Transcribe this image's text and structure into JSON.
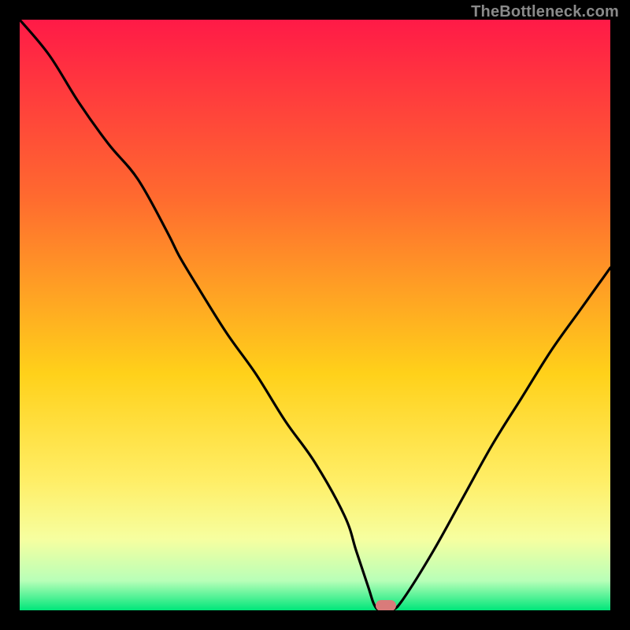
{
  "watermark": "TheBottleneck.com",
  "colors": {
    "top": "#ff1a47",
    "mid1": "#ff6a2f",
    "mid2": "#ffd11a",
    "mid3": "#ffee66",
    "mid4": "#f6ffa0",
    "low": "#b8ffb8",
    "bottom": "#00e67a",
    "curve": "#000000",
    "marker": "#d97b7a",
    "frame": "#000000"
  },
  "chart_data": {
    "type": "line",
    "title": "",
    "xlabel": "",
    "ylabel": "",
    "xlim": [
      0,
      100
    ],
    "ylim": [
      0,
      100
    ],
    "grid": false,
    "legend": false,
    "annotations": [],
    "series": [
      {
        "name": "bottleneck-curve",
        "x": [
          0,
          5,
          10,
          15,
          20,
          25,
          27,
          30,
          35,
          40,
          45,
          50,
          55,
          57,
          59,
          60,
          61,
          63,
          65,
          70,
          75,
          80,
          85,
          90,
          95,
          100
        ],
        "y": [
          100,
          94,
          86,
          79,
          73,
          64,
          60,
          55,
          47,
          40,
          32,
          25,
          16,
          10,
          4,
          1,
          0,
          0,
          2,
          10,
          19,
          28,
          36,
          44,
          51,
          58
        ]
      }
    ],
    "marker": {
      "x": 62,
      "y": 0
    },
    "gradient_stops": [
      {
        "offset": 0.0,
        "bottleneck_pct": 100
      },
      {
        "offset": 0.3,
        "bottleneck_pct": 70
      },
      {
        "offset": 0.6,
        "bottleneck_pct": 40
      },
      {
        "offset": 0.78,
        "bottleneck_pct": 22
      },
      {
        "offset": 0.88,
        "bottleneck_pct": 12
      },
      {
        "offset": 0.95,
        "bottleneck_pct": 5
      },
      {
        "offset": 1.0,
        "bottleneck_pct": 0
      }
    ]
  }
}
